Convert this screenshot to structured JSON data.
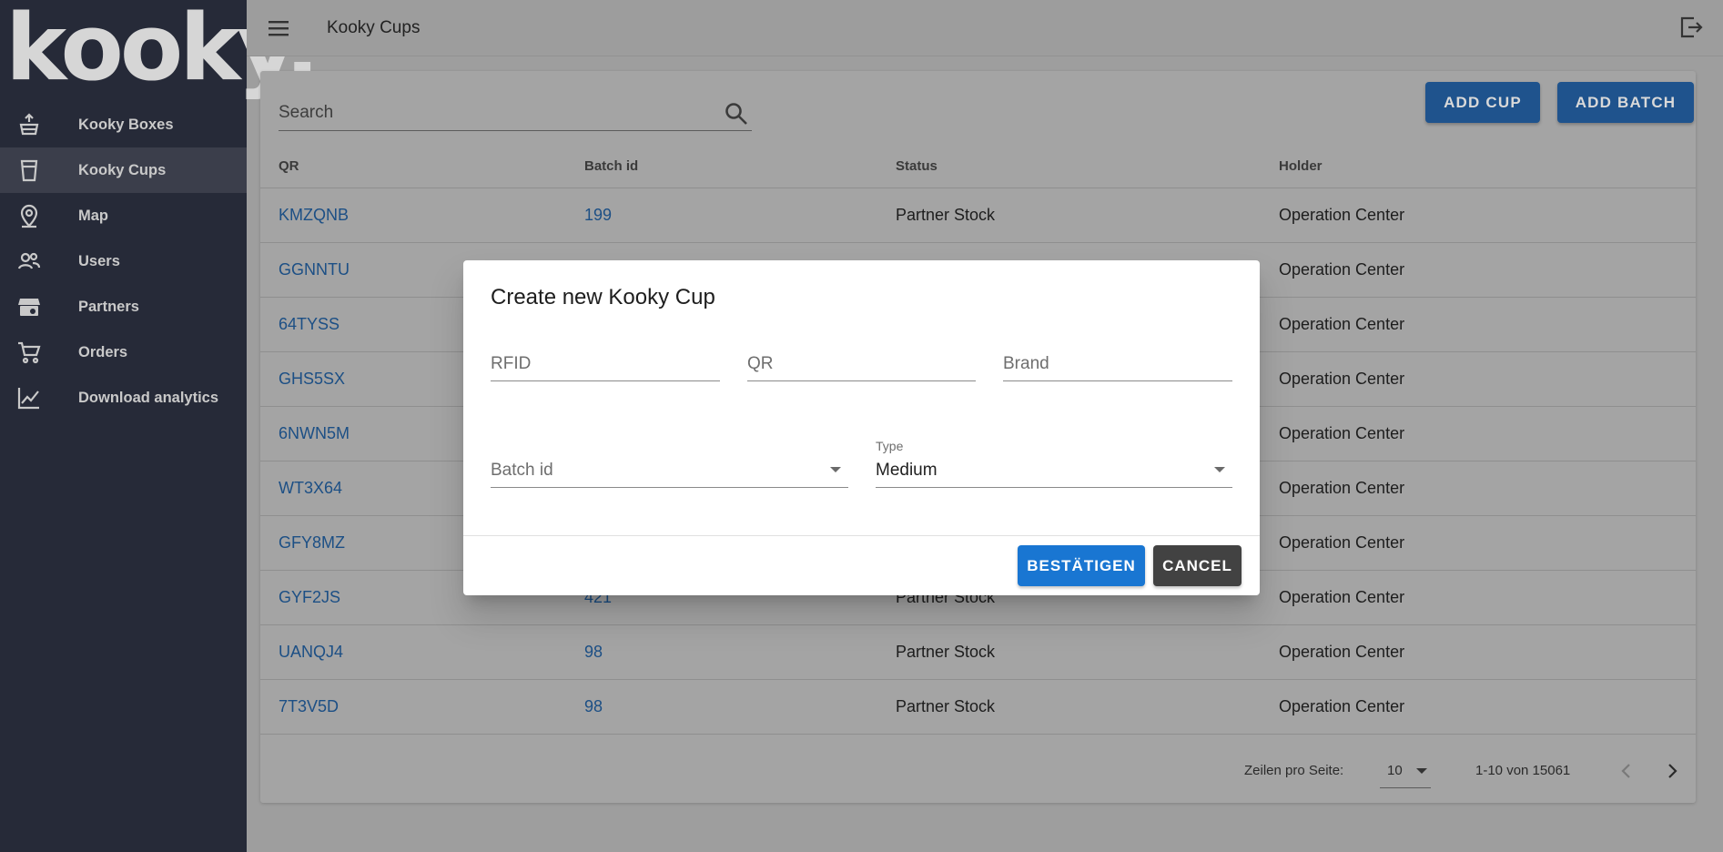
{
  "app": {
    "logo": "kooky."
  },
  "sidebar": {
    "items": [
      {
        "label": "Kooky Boxes",
        "icon": "box-upload-icon"
      },
      {
        "label": "Kooky Cups",
        "icon": "cup-icon",
        "active": true
      },
      {
        "label": "Map",
        "icon": "map-pin-icon"
      },
      {
        "label": "Users",
        "icon": "users-icon"
      },
      {
        "label": "Partners",
        "icon": "storefront-icon"
      },
      {
        "label": "Orders",
        "icon": "cart-icon"
      },
      {
        "label": "Download analytics",
        "icon": "chart-line-icon"
      }
    ]
  },
  "topbar": {
    "title": "Kooky Cups"
  },
  "main": {
    "search": {
      "placeholder": "Search"
    },
    "buttons": {
      "add_cup": "ADD CUP",
      "add_batch": "ADD BATCH"
    },
    "table": {
      "headers": [
        "QR",
        "Batch id",
        "Status",
        "Holder"
      ],
      "rows": [
        {
          "qr": "KMZQNB",
          "batch": "199",
          "status": "Partner Stock",
          "holder": "Operation Center"
        },
        {
          "qr": "GGNNTU",
          "batch": "",
          "status": "",
          "holder": "Operation Center"
        },
        {
          "qr": "64TYSS",
          "batch": "",
          "status": "",
          "holder": "Operation Center"
        },
        {
          "qr": "GHS5SX",
          "batch": "",
          "status": "",
          "holder": "Operation Center"
        },
        {
          "qr": "6NWN5M",
          "batch": "",
          "status": "",
          "holder": "Operation Center"
        },
        {
          "qr": "WT3X64",
          "batch": "",
          "status": "",
          "holder": "Operation Center"
        },
        {
          "qr": "GFY8MZ",
          "batch": "",
          "status": "",
          "holder": "Operation Center"
        },
        {
          "qr": "GYF2JS",
          "batch": "421",
          "status": "Partner Stock",
          "holder": "Operation Center"
        },
        {
          "qr": "UANQJ4",
          "batch": "98",
          "status": "Partner Stock",
          "holder": "Operation Center"
        },
        {
          "qr": "7T3V5D",
          "batch": "98",
          "status": "Partner Stock",
          "holder": "Operation Center"
        }
      ]
    },
    "pagination": {
      "rows_label": "Zeilen pro Seite:",
      "rows_value": "10",
      "range": "1-10 von 15061"
    }
  },
  "dialog": {
    "title": "Create new Kooky Cup",
    "fields": {
      "rfid_placeholder": "RFID",
      "qr_placeholder": "QR",
      "brand_placeholder": "Brand"
    },
    "batch_select": {
      "placeholder": "Batch id"
    },
    "type_select": {
      "label": "Type",
      "value": "Medium"
    },
    "buttons": {
      "confirm": "BESTÄTIGEN",
      "cancel": "CANCEL"
    }
  },
  "colors": {
    "sidebar_bg": "#262a38",
    "primary": "#1976d2",
    "cancel": "#424242",
    "link": "#1c4f85"
  }
}
